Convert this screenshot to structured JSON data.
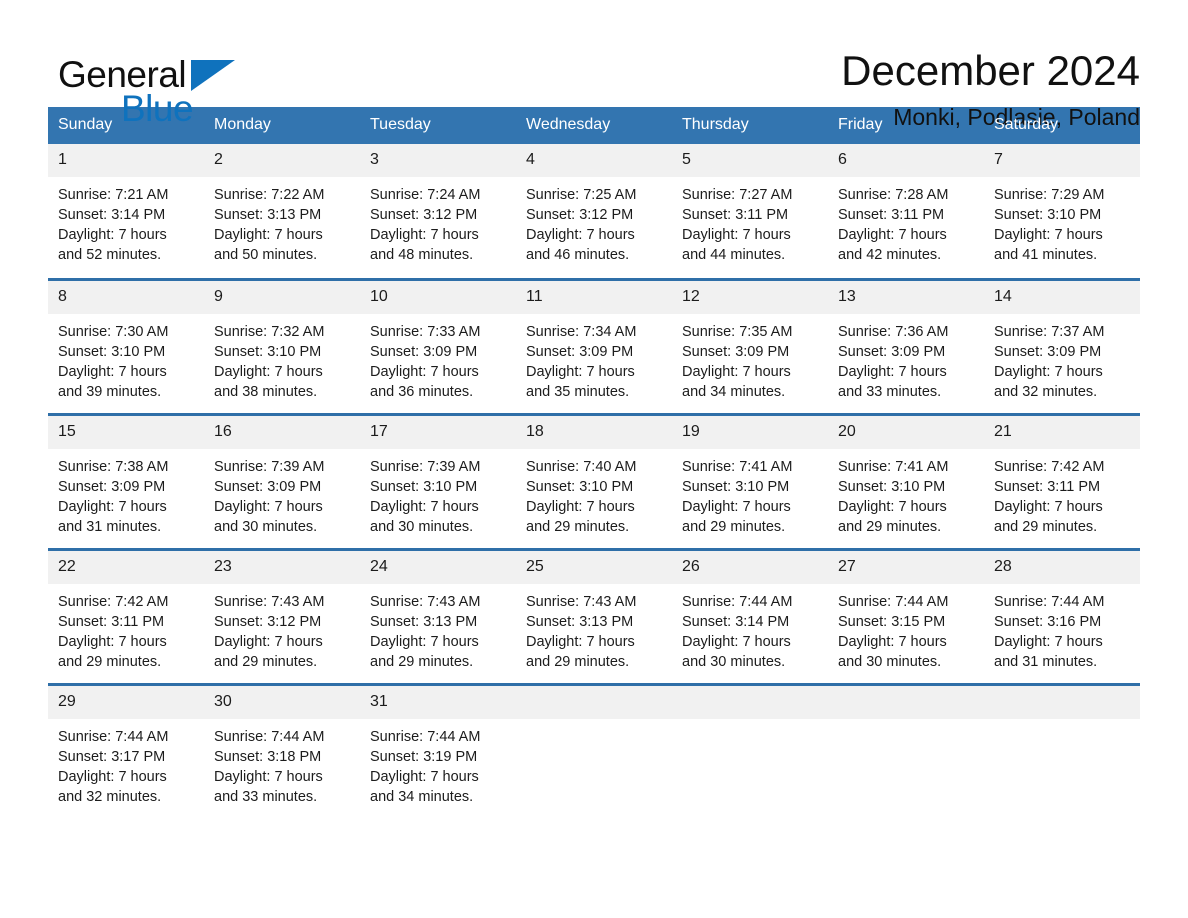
{
  "brand": {
    "name_part1": "General",
    "name_part2": "Blue",
    "triangle_color": "#0f72bd"
  },
  "header": {
    "month_title": "December 2024",
    "location": "Monki, Podlasie, Poland"
  },
  "theme": {
    "header_bg": "#3375b0",
    "row_divider": "#2f6fa8",
    "daynum_bg": "#f1f1f1",
    "text": "#1c1c1c"
  },
  "weekday_headers": [
    "Sunday",
    "Monday",
    "Tuesday",
    "Wednesday",
    "Thursday",
    "Friday",
    "Saturday"
  ],
  "weeks": [
    [
      {
        "day": "1",
        "info": "Sunrise: 7:21 AM\nSunset: 3:14 PM\nDaylight: 7 hours\nand 52 minutes."
      },
      {
        "day": "2",
        "info": "Sunrise: 7:22 AM\nSunset: 3:13 PM\nDaylight: 7 hours\nand 50 minutes."
      },
      {
        "day": "3",
        "info": "Sunrise: 7:24 AM\nSunset: 3:12 PM\nDaylight: 7 hours\nand 48 minutes."
      },
      {
        "day": "4",
        "info": "Sunrise: 7:25 AM\nSunset: 3:12 PM\nDaylight: 7 hours\nand 46 minutes."
      },
      {
        "day": "5",
        "info": "Sunrise: 7:27 AM\nSunset: 3:11 PM\nDaylight: 7 hours\nand 44 minutes."
      },
      {
        "day": "6",
        "info": "Sunrise: 7:28 AM\nSunset: 3:11 PM\nDaylight: 7 hours\nand 42 minutes."
      },
      {
        "day": "7",
        "info": "Sunrise: 7:29 AM\nSunset: 3:10 PM\nDaylight: 7 hours\nand 41 minutes."
      }
    ],
    [
      {
        "day": "8",
        "info": "Sunrise: 7:30 AM\nSunset: 3:10 PM\nDaylight: 7 hours\nand 39 minutes."
      },
      {
        "day": "9",
        "info": "Sunrise: 7:32 AM\nSunset: 3:10 PM\nDaylight: 7 hours\nand 38 minutes."
      },
      {
        "day": "10",
        "info": "Sunrise: 7:33 AM\nSunset: 3:09 PM\nDaylight: 7 hours\nand 36 minutes."
      },
      {
        "day": "11",
        "info": "Sunrise: 7:34 AM\nSunset: 3:09 PM\nDaylight: 7 hours\nand 35 minutes."
      },
      {
        "day": "12",
        "info": "Sunrise: 7:35 AM\nSunset: 3:09 PM\nDaylight: 7 hours\nand 34 minutes."
      },
      {
        "day": "13",
        "info": "Sunrise: 7:36 AM\nSunset: 3:09 PM\nDaylight: 7 hours\nand 33 minutes."
      },
      {
        "day": "14",
        "info": "Sunrise: 7:37 AM\nSunset: 3:09 PM\nDaylight: 7 hours\nand 32 minutes."
      }
    ],
    [
      {
        "day": "15",
        "info": "Sunrise: 7:38 AM\nSunset: 3:09 PM\nDaylight: 7 hours\nand 31 minutes."
      },
      {
        "day": "16",
        "info": "Sunrise: 7:39 AM\nSunset: 3:09 PM\nDaylight: 7 hours\nand 30 minutes."
      },
      {
        "day": "17",
        "info": "Sunrise: 7:39 AM\nSunset: 3:10 PM\nDaylight: 7 hours\nand 30 minutes."
      },
      {
        "day": "18",
        "info": "Sunrise: 7:40 AM\nSunset: 3:10 PM\nDaylight: 7 hours\nand 29 minutes."
      },
      {
        "day": "19",
        "info": "Sunrise: 7:41 AM\nSunset: 3:10 PM\nDaylight: 7 hours\nand 29 minutes."
      },
      {
        "day": "20",
        "info": "Sunrise: 7:41 AM\nSunset: 3:10 PM\nDaylight: 7 hours\nand 29 minutes."
      },
      {
        "day": "21",
        "info": "Sunrise: 7:42 AM\nSunset: 3:11 PM\nDaylight: 7 hours\nand 29 minutes."
      }
    ],
    [
      {
        "day": "22",
        "info": "Sunrise: 7:42 AM\nSunset: 3:11 PM\nDaylight: 7 hours\nand 29 minutes."
      },
      {
        "day": "23",
        "info": "Sunrise: 7:43 AM\nSunset: 3:12 PM\nDaylight: 7 hours\nand 29 minutes."
      },
      {
        "day": "24",
        "info": "Sunrise: 7:43 AM\nSunset: 3:13 PM\nDaylight: 7 hours\nand 29 minutes."
      },
      {
        "day": "25",
        "info": "Sunrise: 7:43 AM\nSunset: 3:13 PM\nDaylight: 7 hours\nand 29 minutes."
      },
      {
        "day": "26",
        "info": "Sunrise: 7:44 AM\nSunset: 3:14 PM\nDaylight: 7 hours\nand 30 minutes."
      },
      {
        "day": "27",
        "info": "Sunrise: 7:44 AM\nSunset: 3:15 PM\nDaylight: 7 hours\nand 30 minutes."
      },
      {
        "day": "28",
        "info": "Sunrise: 7:44 AM\nSunset: 3:16 PM\nDaylight: 7 hours\nand 31 minutes."
      }
    ],
    [
      {
        "day": "29",
        "info": "Sunrise: 7:44 AM\nSunset: 3:17 PM\nDaylight: 7 hours\nand 32 minutes."
      },
      {
        "day": "30",
        "info": "Sunrise: 7:44 AM\nSunset: 3:18 PM\nDaylight: 7 hours\nand 33 minutes."
      },
      {
        "day": "31",
        "info": "Sunrise: 7:44 AM\nSunset: 3:19 PM\nDaylight: 7 hours\nand 34 minutes."
      },
      {
        "day": "",
        "info": ""
      },
      {
        "day": "",
        "info": ""
      },
      {
        "day": "",
        "info": ""
      },
      {
        "day": "",
        "info": ""
      }
    ]
  ]
}
